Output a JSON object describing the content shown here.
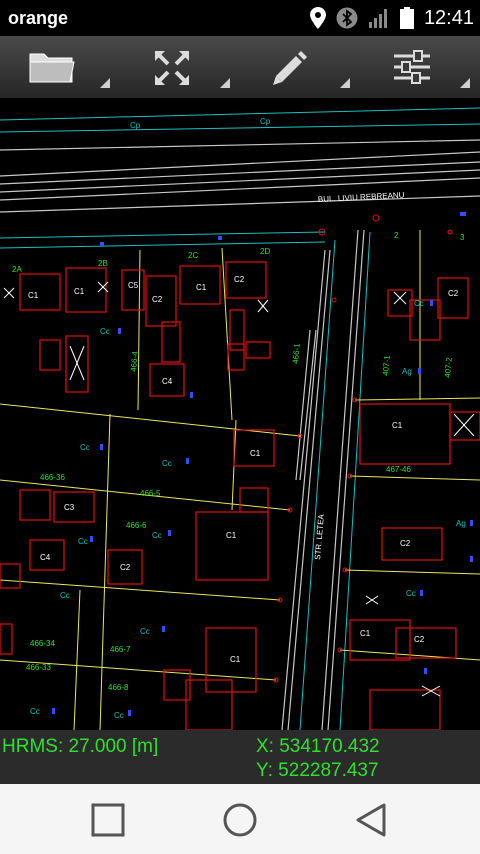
{
  "status_bar": {
    "carrier": "orange",
    "time": "12:41",
    "icons": [
      "location-icon",
      "bluetooth-icon",
      "signal-icon",
      "battery-icon"
    ]
  },
  "toolbar": {
    "tools": [
      "folder-icon",
      "fullscreen-icon",
      "pencil-icon",
      "settings-sliders-icon"
    ]
  },
  "map": {
    "street_labels": [
      "BUL. LIVIU REBREANU",
      "STR. LETEA"
    ],
    "parcel_labels": [
      "2A",
      "2B",
      "2C",
      "2D",
      "2",
      "3",
      "466-5",
      "466-6",
      "466-7",
      "466-8",
      "466-34",
      "466-33",
      "466-36",
      "407-1",
      "407-2",
      "467-46",
      "466-1",
      "466-4"
    ],
    "building_labels": [
      "C1",
      "C2",
      "C3",
      "C4",
      "C5"
    ],
    "land_use_labels": [
      "Cc",
      "Ag",
      "Cp"
    ],
    "colors": {
      "building": "#e01010",
      "parcel": "#e8e85a",
      "road": "#c0c0c0",
      "cadastral": "#18c0c0",
      "labels": "#30e030"
    }
  },
  "readout": {
    "hrms": "HRMS: 27.000 [m]",
    "x": "X: 534170.432",
    "y": "Y: 522287.437"
  },
  "nav_bar": {
    "buttons": [
      "recents-button",
      "home-button",
      "back-button"
    ]
  }
}
